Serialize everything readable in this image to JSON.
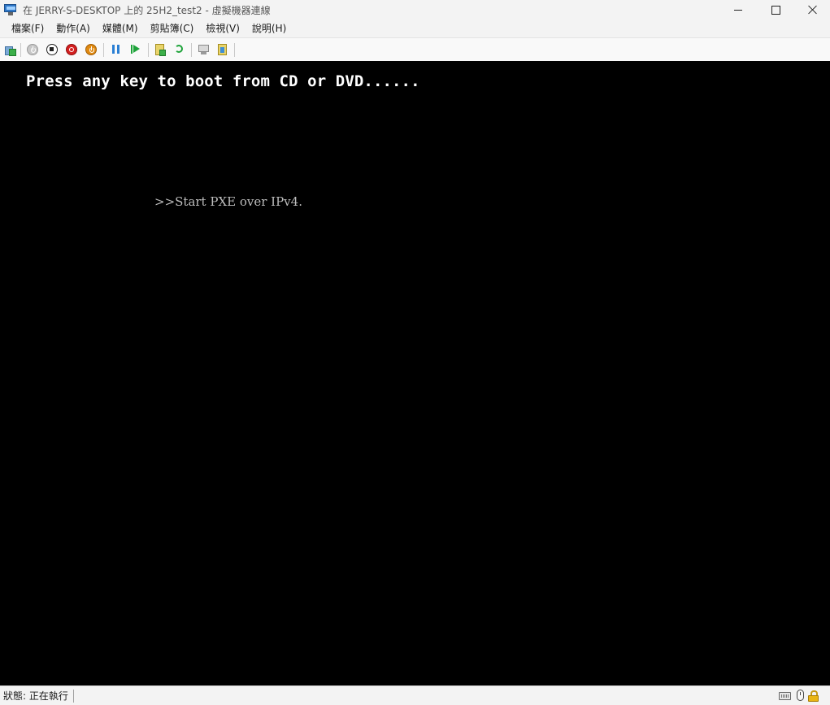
{
  "window": {
    "title": "在 JERRY-S-DESKTOP 上的 25H2_test2 - 虛擬機器連線",
    "icon": "vm-monitor-icon"
  },
  "menu": {
    "items": [
      {
        "label": "檔案(F)"
      },
      {
        "label": "動作(A)"
      },
      {
        "label": "媒體(M)"
      },
      {
        "label": "剪貼簿(C)"
      },
      {
        "label": "檢視(V)"
      },
      {
        "label": "說明(H)"
      }
    ]
  },
  "toolbar": {
    "buttons": [
      {
        "icon": "ctrl-alt-del-icon"
      },
      {
        "icon": "start-power-icon"
      },
      {
        "icon": "turn-off-stop-icon"
      },
      {
        "icon": "shut-down-icon"
      },
      {
        "icon": "save-icon"
      },
      {
        "icon": "pause-icon"
      },
      {
        "icon": "resume-icon"
      },
      {
        "icon": "checkpoint-icon"
      },
      {
        "icon": "revert-icon"
      },
      {
        "icon": "enhanced-session-icon"
      },
      {
        "icon": "share-icon"
      }
    ]
  },
  "screen": {
    "boot_message": "Press any key to boot from CD or DVD......",
    "pxe_message": ">>Start PXE over IPv4."
  },
  "status": {
    "text": "狀態: 正在執行"
  },
  "colors": {
    "screen_background": "#000000",
    "boot_text": "#ffffff",
    "pxe_text": "#bdbdbd",
    "chrome_background": "#f3f3f3"
  }
}
